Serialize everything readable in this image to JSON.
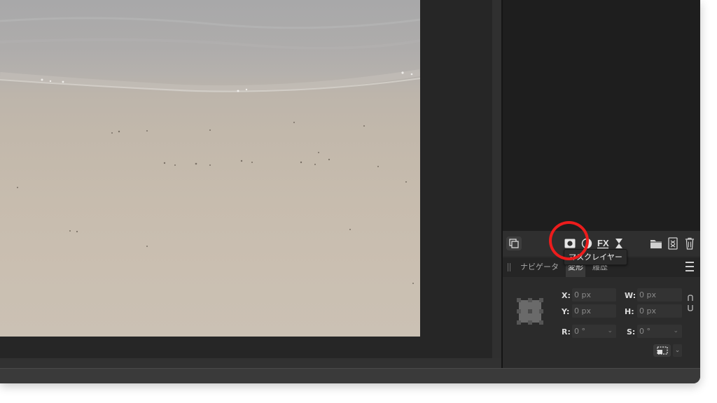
{
  "tooltip": {
    "text": "マスクレイヤー"
  },
  "tabs": {
    "navigator": "ナビゲータ",
    "transform": "変形",
    "history": "履歴"
  },
  "transform": {
    "x_label": "X:",
    "x_value": "0 px",
    "y_label": "Y:",
    "y_value": "0 px",
    "w_label": "W:",
    "w_value": "0 px",
    "h_label": "H:",
    "h_value": "0 px",
    "r_label": "R:",
    "r_value": "0 °",
    "s_label": "S:",
    "s_value": "0 °"
  },
  "layers_toolbar": {
    "icons": [
      "layers-toggle-icon",
      "mask-layer-icon",
      "adjustment-layer-icon",
      "fx-icon",
      "live-filter-icon",
      "folder-icon",
      "group-icon",
      "trash-icon"
    ]
  },
  "colors": {
    "highlight_ring": "#ec1c1c",
    "window_background": "#2c2c2c",
    "layers_panel_background": "#1e1e1e"
  }
}
